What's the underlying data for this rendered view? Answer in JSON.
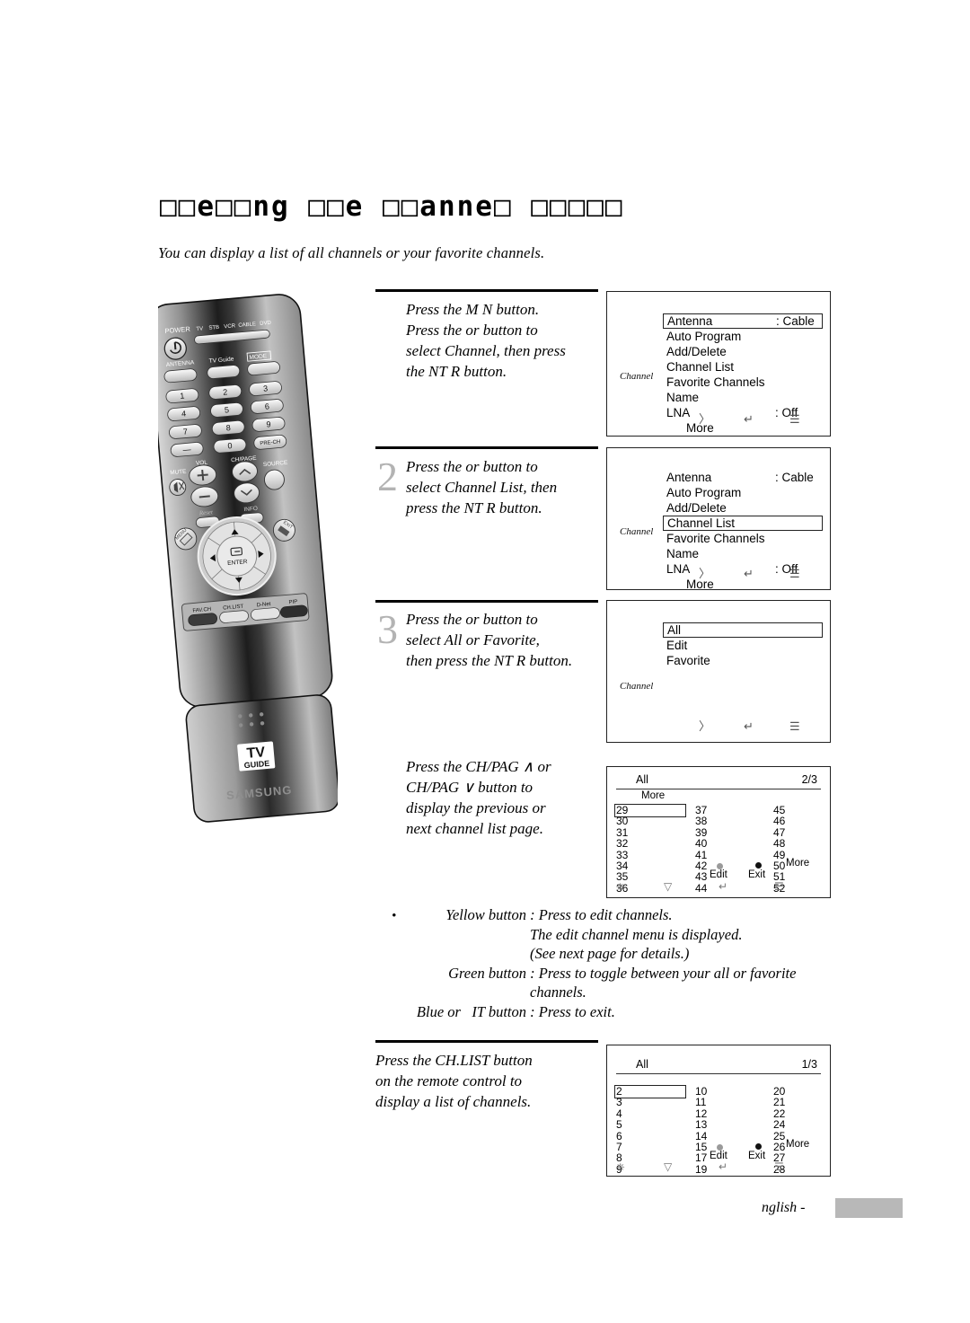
{
  "heading": {
    "title": "□□e□□ng □□e □□anne□ □□□□□",
    "subtitle": "You can display a list of all channels or your favorite channels."
  },
  "remote": {
    "power_label": "POWER",
    "modes": [
      "TV",
      "STB",
      "VCR",
      "CABLE",
      "DVD"
    ],
    "antenna_label": "ANTENNA",
    "tvguide_label": "TV Guide",
    "mode_label": "MODE",
    "keys": [
      "1",
      "2",
      "3",
      "4",
      "5",
      "6",
      "7",
      "8",
      "9",
      "—",
      "0",
      "PRE-CH"
    ],
    "vol_label": "VOL",
    "chpage_label": "CH/PAGE",
    "mute_label": "MUTE",
    "source_label": "SOURCE",
    "reset_label": "Reset",
    "info_label": "INFO",
    "menu_label": "MENU",
    "exit_label": "EXIT",
    "enter_label": "ENTER",
    "bottom_keys": [
      "FAV.CH",
      "CH.LIST",
      "D-Net",
      "PIP"
    ],
    "brand_tv": "TV",
    "brand_guide": "GUIDE",
    "brand": "SAMSUNG"
  },
  "steps": [
    {
      "number": "",
      "text": "Press the M N  button.\nPress the    or    button to\nselect Channel, then press\nthe  NT R button."
    },
    {
      "number": "2",
      "text": "Press the    or    button to\nselect Channel List, then\npress the  NT R button."
    },
    {
      "number": "3",
      "text": "Press the    or   button to\nselect All or Favorite,\nthen press the  NT R button."
    },
    {
      "number": "",
      "text": "Press the CH/PAG  ∧ or\nCH/PAG  ∨ button to\ndisplay the previous or\nnext channel list page."
    },
    {
      "number": "",
      "text": "Press the CH.LIST button\non the remote control to\ndisplay a list of channels."
    }
  ],
  "osd1": {
    "side_label": "Channel",
    "rows": [
      {
        "label": "Antenna",
        "value": ": Cable",
        "selected": true,
        "indent": false
      },
      {
        "label": "Auto Program",
        "value": "",
        "selected": false,
        "indent": false
      },
      {
        "label": "Add/Delete",
        "value": "",
        "selected": false,
        "indent": false
      },
      {
        "label": "Channel List",
        "value": "",
        "selected": false,
        "indent": false
      },
      {
        "label": "Favorite Channels",
        "value": "",
        "selected": false,
        "indent": false
      },
      {
        "label": "Name",
        "value": "",
        "selected": false,
        "indent": false
      },
      {
        "label": "LNA",
        "value": ": Off",
        "selected": false,
        "indent": false
      },
      {
        "label": "More",
        "value": "",
        "selected": false,
        "indent": true
      }
    ],
    "foot_icons": [
      "〉",
      "↵",
      "☰"
    ]
  },
  "osd2": {
    "side_label": "Channel",
    "rows": [
      {
        "label": "Antenna",
        "value": ": Cable",
        "selected": false,
        "indent": false
      },
      {
        "label": "Auto Program",
        "value": "",
        "selected": false,
        "indent": false
      },
      {
        "label": "Add/Delete",
        "value": "",
        "selected": false,
        "indent": false
      },
      {
        "label": "Channel List",
        "value": "",
        "selected": true,
        "indent": false
      },
      {
        "label": "Favorite Channels",
        "value": "",
        "selected": false,
        "indent": false
      },
      {
        "label": "Name",
        "value": "",
        "selected": false,
        "indent": false
      },
      {
        "label": "LNA",
        "value": ": Off",
        "selected": false,
        "indent": false
      },
      {
        "label": "More",
        "value": "",
        "selected": false,
        "indent": true
      }
    ],
    "foot_icons": [
      "〉",
      "↵",
      "☰"
    ]
  },
  "osd3": {
    "side_label": "Channel",
    "rows": [
      {
        "label": "All",
        "value": "",
        "selected": true,
        "indent": false
      },
      {
        "label": "Edit",
        "value": "",
        "selected": false,
        "indent": false
      },
      {
        "label": "Favorite",
        "value": "",
        "selected": false,
        "indent": false
      }
    ],
    "foot_icons": [
      "〉",
      "↵",
      "☰"
    ]
  },
  "channel_list_page2": {
    "title": "All",
    "page": "2/3",
    "more_top": "More",
    "more_bottom": "More",
    "col1": [
      "29",
      "30",
      "31",
      "32",
      "33",
      "34",
      "35",
      "36"
    ],
    "col2": [
      "37",
      "38",
      "39",
      "40",
      "41",
      "42",
      "43",
      "44"
    ],
    "col3": [
      "45",
      "46",
      "47",
      "48",
      "49",
      "50",
      "51",
      "52"
    ],
    "selected": "29",
    "edit_label": "Edit",
    "exit_label": "Exit",
    "edit_dot_color": "#9a9a9a",
    "exit_dot_color": "#111111",
    "foot_icons": [
      "⎈",
      "▽",
      "↵",
      "☰"
    ]
  },
  "channel_list_page1": {
    "title": "All",
    "page": "1/3",
    "more_bottom": "More",
    "col1": [
      "2",
      "3",
      "4",
      "5",
      "6",
      "7",
      "8",
      "9"
    ],
    "col2": [
      "10",
      "11",
      "12",
      "13",
      "14",
      "15",
      "17",
      "19"
    ],
    "col3": [
      "20",
      "21",
      "22",
      "24",
      "25",
      "26",
      "27",
      "28"
    ],
    "selected": "2",
    "edit_label": "Edit",
    "exit_label": "Exit",
    "edit_dot_color": "#9a9a9a",
    "exit_dot_color": "#111111",
    "foot_icons": [
      "⎈",
      "▽",
      "↵",
      "☰"
    ]
  },
  "notes": {
    "l1_label": "Yellow button",
    "l1_text": " : Press to edit channels.",
    "l2_text": "The edit channel menu is displayed.",
    "l3_text": "(See next page for details.)",
    "l4_label": "Green button",
    "l4_text": " : Press to toggle between your all or favorite",
    "l5_text": "channels.",
    "l6_label": "Blue or   IT button",
    "l6_text": " : Press to exit."
  },
  "footer": {
    "text": "nglish -"
  }
}
